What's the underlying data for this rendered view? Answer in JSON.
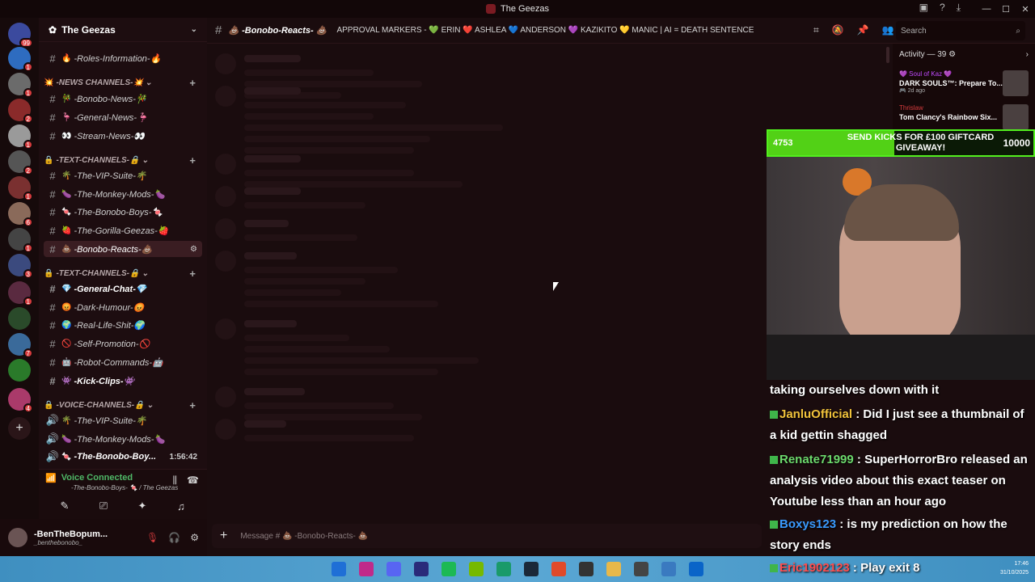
{
  "window": {
    "title": "The Geezas"
  },
  "guild": {
    "name": "The Geezas"
  },
  "channels": [
    {
      "type": "channel",
      "emoji": "🔥",
      "label": "-Roles-Information-",
      "suffix": "🔥"
    },
    {
      "type": "category",
      "emoji": "💥",
      "label": "-NEWS CHANNELS-",
      "suffix": "💥"
    },
    {
      "type": "channel",
      "emoji": "🎋",
      "label": "-Bonobo-News-",
      "suffix": "🎋"
    },
    {
      "type": "channel",
      "emoji": "🦩",
      "label": "-General-News-",
      "suffix": "🦩"
    },
    {
      "type": "channel",
      "emoji": "👀",
      "label": "-Stream-News-",
      "suffix": "👀"
    },
    {
      "type": "category",
      "emoji": "🔒",
      "label": "-TEXT-CHANNELS-",
      "suffix": "🔒"
    },
    {
      "type": "channel",
      "emoji": "🌴",
      "label": "-The-VIP-Suite-",
      "suffix": "🌴"
    },
    {
      "type": "channel",
      "emoji": "🍆",
      "label": "-The-Monkey-Mods-",
      "suffix": "🍆"
    },
    {
      "type": "channel",
      "emoji": "🍬",
      "label": "-The-Bonobo-Boys-",
      "suffix": "🍬"
    },
    {
      "type": "channel",
      "emoji": "🍓",
      "label": "-The-Gorilla-Geezas-",
      "suffix": "🍓"
    },
    {
      "type": "channel",
      "emoji": "💩",
      "label": "-Bonobo-Reacts-",
      "suffix": "💩",
      "active": true
    },
    {
      "type": "category",
      "emoji": "🔒",
      "label": "-TEXT-CHANNELS-",
      "suffix": "🔒"
    },
    {
      "type": "channel",
      "emoji": "💎",
      "label": "-General-Chat-",
      "suffix": "💎",
      "bold": true
    },
    {
      "type": "channel",
      "emoji": "😡",
      "label": "-Dark-Humour-",
      "suffix": "😡"
    },
    {
      "type": "channel",
      "emoji": "🌍",
      "label": "-Real-Life-Shit-",
      "suffix": "🌍"
    },
    {
      "type": "channel",
      "emoji": "🚫",
      "label": "-Self-Promotion-",
      "suffix": "🚫"
    },
    {
      "type": "channel",
      "emoji": "🤖",
      "label": "-Robot-Commands-",
      "suffix": "🤖"
    },
    {
      "type": "channel",
      "emoji": "👾",
      "label": "-Kick-Clips-",
      "suffix": "👾",
      "bold": true
    },
    {
      "type": "category",
      "emoji": "🔒",
      "label": "-VOICE-CHANNELS-",
      "suffix": "🔒"
    },
    {
      "type": "voice",
      "emoji": "🌴",
      "label": "-The-VIP-Suite-",
      "suffix": "🌴"
    },
    {
      "type": "voice",
      "emoji": "🍆",
      "label": "-The-Monkey-Mods-",
      "suffix": "🍆"
    },
    {
      "type": "voice",
      "emoji": "🍬",
      "label": "-The-Bonobo-Boy...",
      "suffix": "",
      "tail": "1:56:42",
      "bold": true
    }
  ],
  "voice": {
    "status": "Voice Connected",
    "location": "-The-Bonobo-Boys- 🍬 / The Geezas"
  },
  "user": {
    "name": "-BenTheBopum...",
    "handle": "_benthebonobo_"
  },
  "topbar": {
    "channel": "💩 -Bonobo-Reacts- 💩",
    "topic": "APPROVAL MARKERS - 💚 ERIN ❤️ ASHLEA 💙 ANDERSON 💜 KAZIKITO 💛 MANIC | AI = DEATH SENTENCE",
    "search_placeholder": "Search"
  },
  "composer": {
    "placeholder": "Message # 💩 -Bonobo-Reacts- 💩"
  },
  "activity": {
    "header": "Activity — 39 ⚙",
    "items": [
      {
        "user": "💜 Soul of Kaz 💜",
        "game": "DARK SOULS™: Prepare To...",
        "time": "🎮 2d ago"
      },
      {
        "user": "Thrislaw",
        "game": "Tom Clancy's Rainbow Six...",
        "time": ""
      }
    ]
  },
  "overlay": {
    "current": "4753",
    "goal": "10000",
    "progress": 0.4753,
    "text": "SEND KICKS FOR £100 GIFTCARD GIVEAWAY!"
  },
  "chat": [
    {
      "user": "",
      "msg": "taking ourselves down with it"
    },
    {
      "user": "JanluOfficial",
      "msg": ": Did I just see a thumbnail of a kid gettin shagged"
    },
    {
      "user": "Renate71999",
      "msg": ": SuperHorrorBro released an analysis video about this exact teaser on Youtube less than an hour ago"
    },
    {
      "user": "Boxys123",
      "msg": ": is my prediction on how the story ends"
    },
    {
      "user": "Eric1902123",
      "msg": ": Play exit 8"
    }
  ],
  "tray": {
    "time": "17:46",
    "date": "31/10/2025"
  },
  "colors": {
    "accent": "#52d116",
    "brand": "#7a1b22",
    "voice_green": "#4fb867"
  }
}
